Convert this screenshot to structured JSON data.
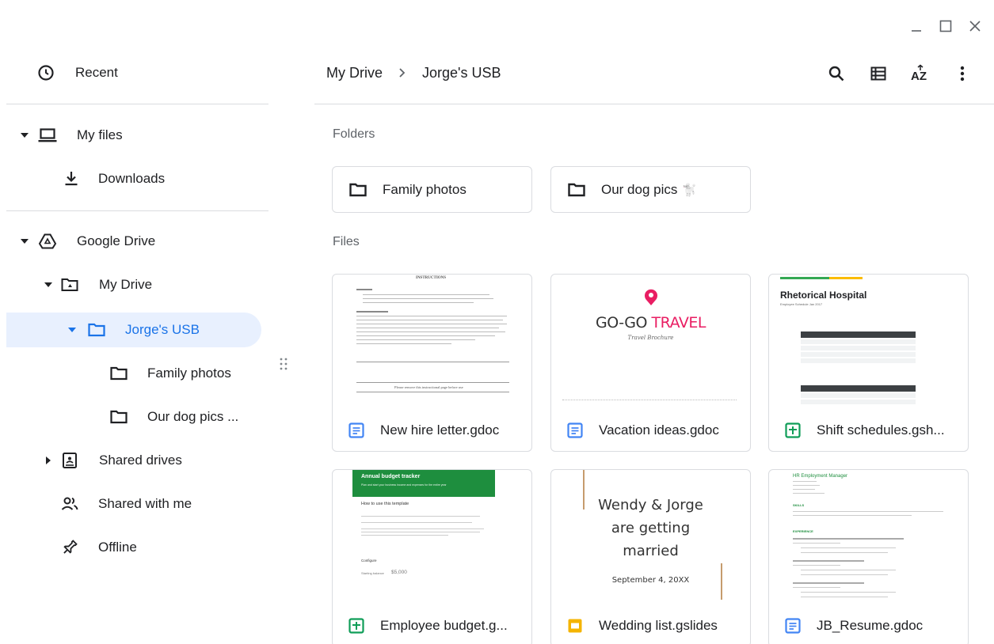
{
  "window": {
    "minimize_icon": "minimize-icon",
    "maximize_icon": "maximize-icon",
    "close_icon": "close-icon"
  },
  "sidebar": {
    "recent": "Recent",
    "my_files": "My files",
    "downloads": "Downloads",
    "google_drive": "Google Drive",
    "my_drive": "My Drive",
    "jorges_usb": "Jorge's USB",
    "family_photos": "Family photos",
    "our_dog_pics": "Our dog pics ...",
    "shared_drives": "Shared drives",
    "shared_with_me": "Shared with me",
    "offline": "Offline"
  },
  "breadcrumb": {
    "root": "My Drive",
    "current": "Jorge's USB"
  },
  "toolbar": {
    "icons": [
      "search-icon",
      "list-view-icon",
      "sort-az-icon",
      "more-vert-icon"
    ]
  },
  "sections": {
    "folders": "Folders",
    "files": "Files"
  },
  "folders": [
    {
      "name": "Family photos"
    },
    {
      "name": "Our dog pics",
      "emoji": "🐩"
    }
  ],
  "files": [
    {
      "name": "New hire letter.gdoc",
      "type": "doc"
    },
    {
      "name": "Vacation ideas.gdoc",
      "type": "doc"
    },
    {
      "name": "Shift schedules.gsh...",
      "type": "sheet"
    },
    {
      "name": "Employee budget.g...",
      "type": "sheet"
    },
    {
      "name": "Wedding list.gslides",
      "type": "slides"
    },
    {
      "name": "JB_Resume.gdoc",
      "type": "doc"
    }
  ],
  "thumbs": {
    "hire": {
      "title": "INSTRUCTIONS",
      "footer": "Please remove this instructional page before use"
    },
    "travel": {
      "title_a": "GO-GO",
      "title_b": "TRAVEL",
      "subtitle": "Travel Brochure"
    },
    "shift": {
      "title": "Rhetorical Hospital",
      "subtitle": "Employee Schedule Jan 2017"
    },
    "budget": {
      "title": "Annual budget tracker",
      "subtitle": "Plan and start your business income and expenses for the entire year",
      "howto": "How to use this template",
      "configure": "Configure",
      "balance_label": "Starting balance",
      "balance_value": "$5,000"
    },
    "wedding": {
      "line1": "Wendy & Jorge",
      "line2": "are getting",
      "line3": "married",
      "date": "September 4, 20XX"
    },
    "resume": {
      "title": "HR Employment Manager",
      "skills": "SKILLS",
      "experience": "EXPERIENCE"
    }
  },
  "colors": {
    "accent": "#1a73e8",
    "selected_bg": "#e8f0fe",
    "doc_blue": "#4285f4",
    "sheet_green": "#0f9d58",
    "slides_yellow": "#f4b400"
  }
}
